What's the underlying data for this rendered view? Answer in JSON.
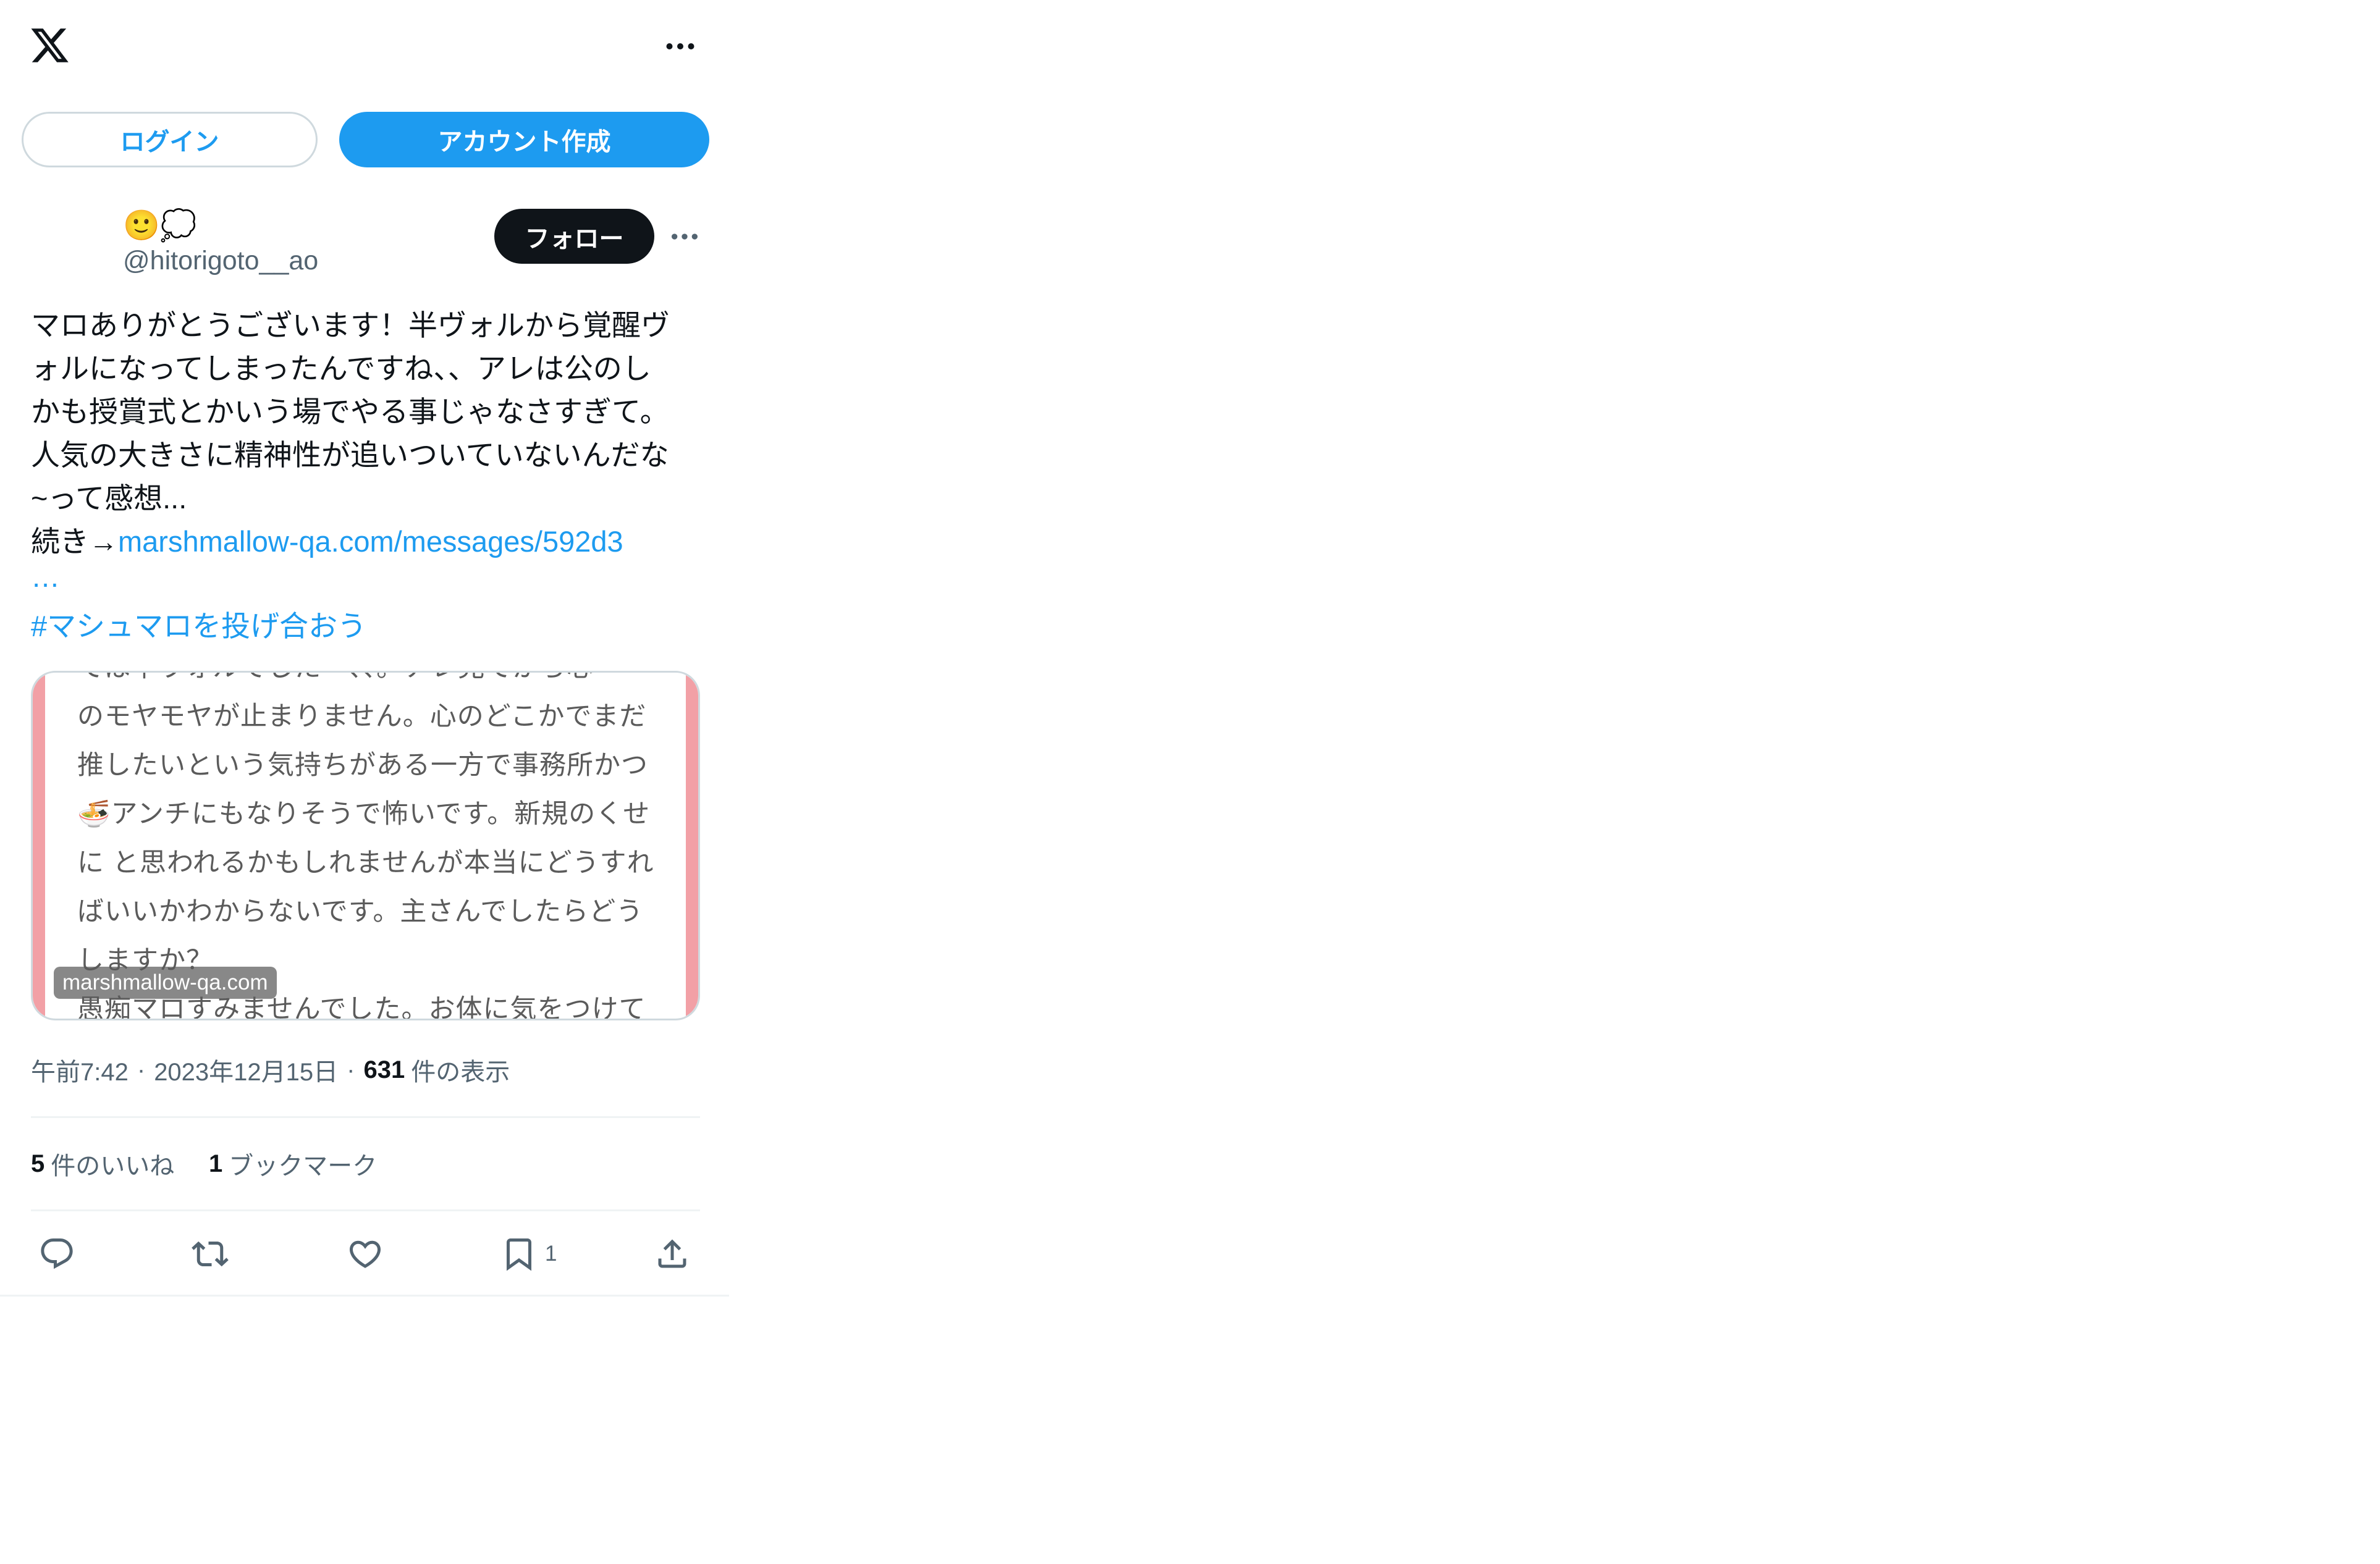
{
  "icons": {
    "logo": "x-logo-icon",
    "header_more": "more-icon",
    "author_more": "more-icon",
    "reply": "reply-icon",
    "retweet": "retweet-icon",
    "like": "heart-icon",
    "bookmark": "bookmark-icon",
    "share": "share-icon"
  },
  "colors": {
    "accent": "#1d9bf0",
    "text": "#0f1419",
    "secondary": "#536471",
    "follow_bg": "#0f1419",
    "card_stripe": "#f2a0a6",
    "divider": "#eff3f4"
  },
  "auth": {
    "login_label": "ログイン",
    "signup_label": "アカウント作成"
  },
  "author": {
    "display_name": "🙂💭",
    "handle": "@hitorigoto__ao",
    "follow_label": "フォロー"
  },
  "tweet": {
    "text_lines": [
      "マロありがとうございます！半ヴォルから覚醒ヴ",
      "ォルになってしまったんですね、、アレは公のし",
      "かも授賞式とかいう場でやる事じゃなさすぎて。",
      "人気の大きさに精神性が追いついていないんだな",
      "~って感想..."
    ],
    "continue_prefix": "続き→",
    "link_text": "marshmallow-qa.com/messages/592d3",
    "link_ellipsis": "…",
    "hashtag": "#マシュマロを投げ合おう"
  },
  "card": {
    "lines": [
      "ては半ヴォルでした一、、。アレ見てから心",
      "のモヤモヤが止まりません。心のどこかでまだ",
      "推したいという気持ちがある一方で事務所かつ",
      "🍜アンチにもなりそうで怖いです。新規のくせ",
      "に と思われるかもしれませんが本当にどうすれ",
      "ばいいかわからないです。主さんでしたらどう",
      "しますか？",
      "愚痴マロすみませんでした。お体に気をつけて"
    ],
    "domain": "marshmallow-qa.com"
  },
  "meta": {
    "time": "午前7:42",
    "separator": "·",
    "date": "2023年12月15日",
    "views_count": "631",
    "views_label": "件の表示"
  },
  "stats": {
    "likes_count": "5",
    "likes_label": "件のいいね",
    "bookmarks_count": "1",
    "bookmarks_label": "ブックマーク"
  },
  "actions": {
    "bookmark_count": "1"
  }
}
